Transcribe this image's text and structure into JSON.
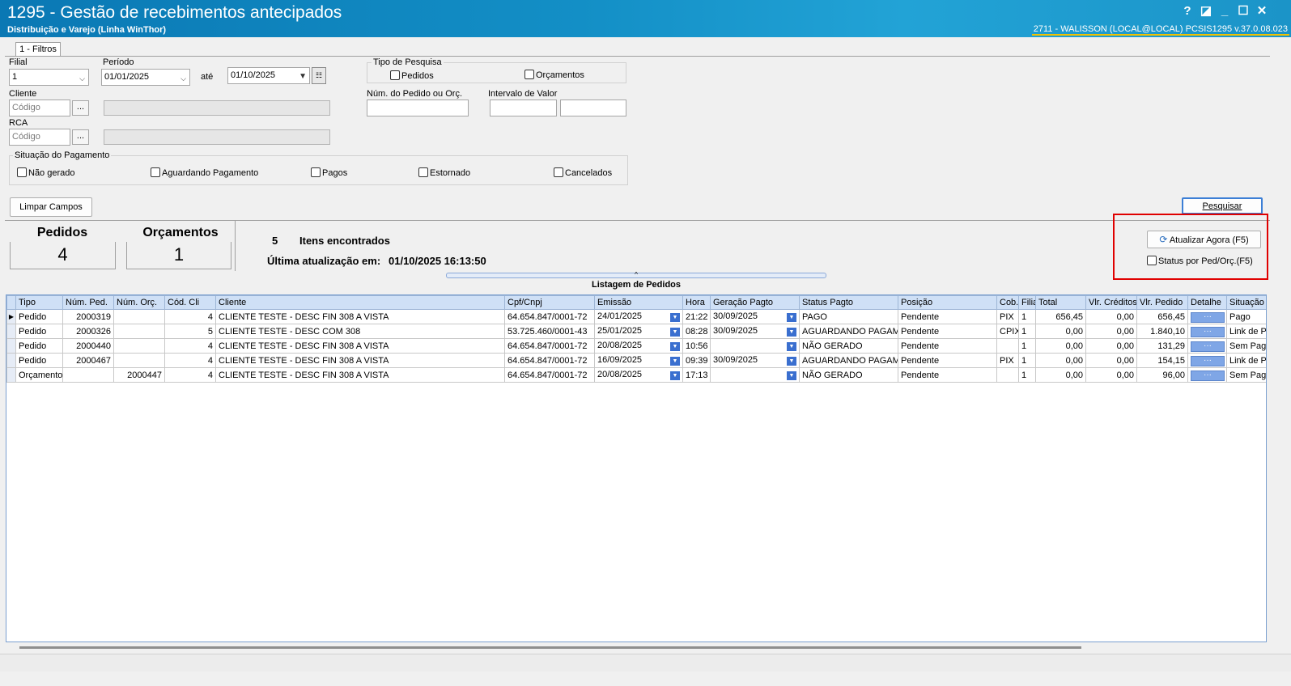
{
  "window": {
    "title": "1295 - Gestão de recebimentos antecipados",
    "subtitle": "Distribuição e Varejo (Linha WinThor)",
    "user_info": "2711 - WALISSON (LOCAL@LOCAL)   PCSIS1295  v.37.0.08.023",
    "controls": {
      "help": "?",
      "restore": "◪",
      "minimize": "_",
      "maximize": "☐",
      "close": "✕"
    }
  },
  "tabs": [
    {
      "label": "1 - Filtros"
    }
  ],
  "filters": {
    "filial_label": "Filial",
    "filial_value": "1",
    "periodo_label": "Período",
    "periodo_from": "01/01/2025",
    "ate_label": "até",
    "periodo_to": "01/10/2025",
    "cliente_label": "Cliente",
    "cliente_placeholder": "Código",
    "rca_label": "RCA",
    "rca_placeholder": "Código",
    "browse_label": "...",
    "tipo_pesquisa_title": "Tipo de Pesquisa",
    "tipo_pedidos": "Pedidos",
    "tipo_orcamentos": "Orçamentos",
    "num_pedido_label": "Núm. do Pedido ou Orç.",
    "intervalo_label": "Intervalo de Valor",
    "situacao_title": "Situação do Pagamento",
    "situacao_options": [
      "Não gerado",
      "Aguardando Pagamento",
      "Pagos",
      "Estornado",
      "Cancelados"
    ]
  },
  "buttons": {
    "limpar": "Limpar Campos",
    "pesquisar": "Pesquisar",
    "atualizar": "Atualizar Agora (F5)",
    "status_por": "Status por Ped/Orç.(F5)"
  },
  "summary": {
    "pedidos_label": "Pedidos",
    "pedidos_value": "4",
    "orcamentos_label": "Orçamentos",
    "orcamentos_value": "1",
    "itens_count": "5",
    "itens_label": "Itens encontrados",
    "ultima_label": "Última atualização em:",
    "ultima_value": "01/10/2025 16:13:50"
  },
  "grid": {
    "title": "Listagem de Pedidos",
    "columns": [
      "Tipo",
      "Núm. Ped.",
      "Núm. Orç.",
      "Cód. Cli",
      "Cliente",
      "Cpf/Cnpj",
      "Emissão",
      "Hora",
      "Geração Pagto",
      "Status Pagto",
      "Posição",
      "Cob.",
      "Filial",
      "Total",
      "Vlr. Créditos",
      "Vlr. Pedido",
      "Detalhe",
      "Situação"
    ],
    "rows": [
      {
        "tipo": "Pedido",
        "num_ped": "2000319",
        "num_orc": "",
        "cod_cli": "4",
        "cliente": "CLIENTE TESTE - DESC FIN 308 A VISTA",
        "cnpj": "64.654.847/0001-72",
        "emissao": "24/01/2025",
        "hora": "21:22",
        "geracao": "30/09/2025",
        "status": "PAGO",
        "posicao": "Pendente",
        "cob": "PIX",
        "filial": "1",
        "total": "656,45",
        "creditos": "0,00",
        "vlr_pedido": "656,45",
        "detalhe": "···",
        "situacao": "Pago"
      },
      {
        "tipo": "Pedido",
        "num_ped": "2000326",
        "num_orc": "",
        "cod_cli": "5",
        "cliente": "CLIENTE TESTE - DESC COM 308",
        "cnpj": "53.725.460/0001-43",
        "emissao": "25/01/2025",
        "hora": "08:28",
        "geracao": "30/09/2025",
        "status": "AGUARDANDO PAGAM",
        "posicao": "Pendente",
        "cob": "CPIX",
        "filial": "1",
        "total": "0,00",
        "creditos": "0,00",
        "vlr_pedido": "1.840,10",
        "detalhe": "···",
        "situacao": "Link de Pa"
      },
      {
        "tipo": "Pedido",
        "num_ped": "2000440",
        "num_orc": "",
        "cod_cli": "4",
        "cliente": "CLIENTE TESTE - DESC FIN 308 A VISTA",
        "cnpj": "64.654.847/0001-72",
        "emissao": "20/08/2025",
        "hora": "10:56",
        "geracao": "",
        "status": "NÃO GERADO",
        "posicao": "Pendente",
        "cob": "",
        "filial": "1",
        "total": "0,00",
        "creditos": "0,00",
        "vlr_pedido": "131,29",
        "detalhe": "···",
        "situacao": "Sem Paga"
      },
      {
        "tipo": "Pedido",
        "num_ped": "2000467",
        "num_orc": "",
        "cod_cli": "4",
        "cliente": "CLIENTE TESTE - DESC FIN 308 A VISTA",
        "cnpj": "64.654.847/0001-72",
        "emissao": "16/09/2025",
        "hora": "09:39",
        "geracao": "30/09/2025",
        "status": "AGUARDANDO PAGAM",
        "posicao": "Pendente",
        "cob": "PIX",
        "filial": "1",
        "total": "0,00",
        "creditos": "0,00",
        "vlr_pedido": "154,15",
        "detalhe": "···",
        "situacao": "Link de Pa"
      },
      {
        "tipo": "Orçamento",
        "num_ped": "",
        "num_orc": "2000447",
        "cod_cli": "4",
        "cliente": "CLIENTE TESTE - DESC FIN 308 A VISTA",
        "cnpj": "64.654.847/0001-72",
        "emissao": "20/08/2025",
        "hora": "17:13",
        "geracao": "",
        "status": "NÃO GERADO",
        "posicao": "Pendente",
        "cob": "",
        "filial": "1",
        "total": "0,00",
        "creditos": "0,00",
        "vlr_pedido": "96,00",
        "detalhe": "···",
        "situacao": "Sem Paga"
      }
    ]
  }
}
